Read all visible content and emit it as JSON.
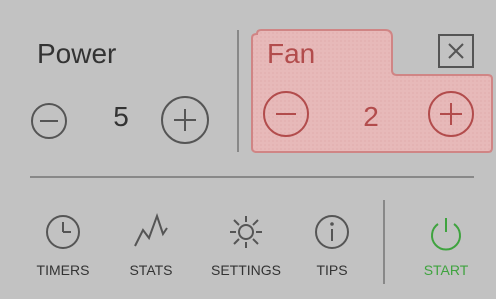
{
  "power": {
    "label": "Power",
    "value": "5"
  },
  "fan": {
    "label": "Fan",
    "value": "2"
  },
  "nav": {
    "timers": "TIMERS",
    "stats": "STATS",
    "settings": "SETTINGS",
    "tips": "TIPS",
    "start": "START"
  },
  "colors": {
    "accent_fan": "#b24c4c",
    "start": "#3fa33f",
    "bg": "#c2c2c2"
  },
  "icons": [
    "minus-icon",
    "plus-icon",
    "close-icon",
    "clock-icon",
    "stats-icon",
    "settings-icon",
    "info-icon",
    "power-icon"
  ]
}
